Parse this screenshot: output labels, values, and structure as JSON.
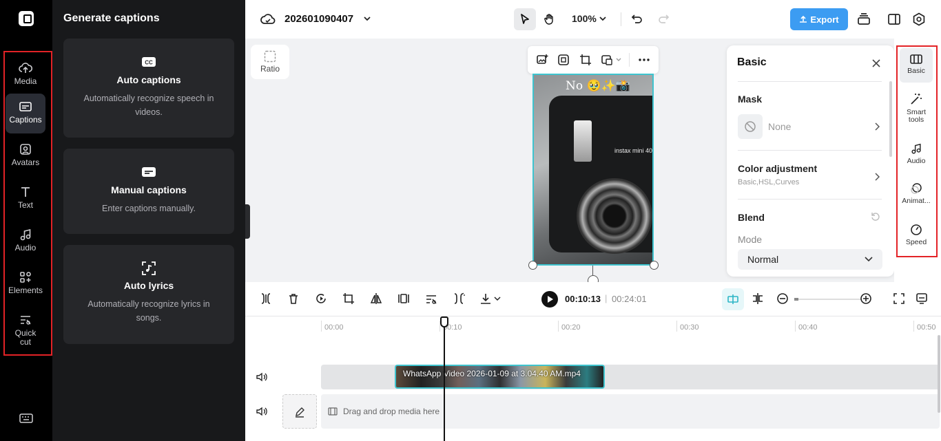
{
  "left_rail": {
    "items": [
      {
        "label": "Media",
        "icon": "upload-cloud-icon"
      },
      {
        "label": "Captions",
        "icon": "captions-icon"
      },
      {
        "label": "Avatars",
        "icon": "avatar-icon"
      },
      {
        "label": "Text",
        "icon": "text-icon"
      },
      {
        "label": "Audio",
        "icon": "music-note-icon"
      },
      {
        "label": "Elements",
        "icon": "elements-icon"
      },
      {
        "label": "Quick",
        "label2": "cut",
        "icon": "quick-cut-icon"
      }
    ],
    "active": "Captions",
    "highlight_color": "#e32226"
  },
  "captions_panel": {
    "title": "Generate captions",
    "cards": [
      {
        "title": "Auto captions",
        "desc": "Automatically recognize speech in videos.",
        "icon": "cc-icon"
      },
      {
        "title": "Manual captions",
        "desc": "Enter captions manually.",
        "icon": "subtitle-icon"
      },
      {
        "title": "Auto lyrics",
        "desc": "Automatically recognize lyrics in songs.",
        "icon": "lyrics-icon"
      }
    ]
  },
  "topbar": {
    "project_name": "202601090407",
    "zoom": "100%",
    "export_label": "Export",
    "accent": "#3c9cf2"
  },
  "canvas": {
    "ratio_label": "Ratio",
    "overlay_text": "No 🥹✨📸",
    "camera_label": "instax mini 40"
  },
  "basic_panel": {
    "title": "Basic",
    "mask_label": "Mask",
    "mask_value": "None",
    "color_adj_label": "Color adjustment",
    "color_adj_sub": "Basic,HSL,Curves",
    "blend_label": "Blend",
    "mode_label": "Mode",
    "mode_value": "Normal"
  },
  "right_rail": {
    "items": [
      {
        "label": "Basic",
        "icon": "basic-film-icon"
      },
      {
        "label": "Smart",
        "label2": "tools",
        "icon": "magic-wand-icon"
      },
      {
        "label": "Audio",
        "icon": "music-note-icon"
      },
      {
        "label": "Animat...",
        "icon": "animation-icon"
      },
      {
        "label": "Speed",
        "icon": "speed-gauge-icon"
      }
    ],
    "active": "Basic"
  },
  "timeline": {
    "current_time": "00:10:13",
    "separator": "|",
    "total_time": "00:24:01",
    "ruler": [
      "00:00",
      "00:10",
      "00:20",
      "00:30",
      "00:40",
      "00:50"
    ],
    "clip_name": "WhatsApp Video 2026-01-09 at 3.04.40 AM.mp4",
    "drop_text": "Drag and drop media here",
    "clip_border": "#3ec4cf"
  }
}
